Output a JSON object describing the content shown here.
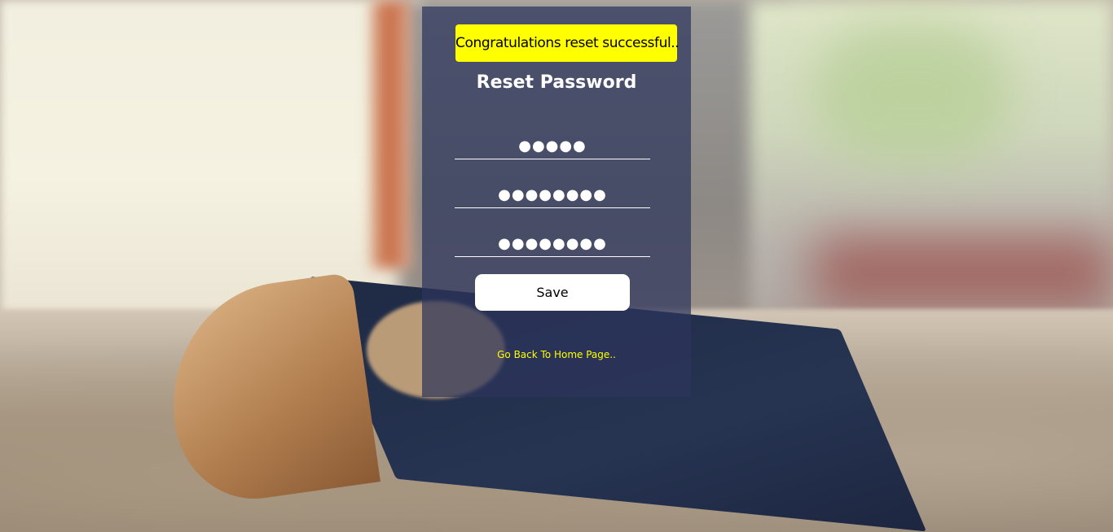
{
  "alert": {
    "message": "Congratulations reset successful..",
    "color": "#ffff00"
  },
  "form": {
    "title": "Reset Password",
    "fields": [
      {
        "value": "●●●●●"
      },
      {
        "value": "●●●●●●●●"
      },
      {
        "value": "●●●●●●●●"
      }
    ],
    "save_label": "Save",
    "home_link": "Go Back To Home Page.."
  },
  "colors": {
    "panel": "rgba(45,52,92,0.72)",
    "link": "#ffff00",
    "button_bg": "#ffffff"
  }
}
